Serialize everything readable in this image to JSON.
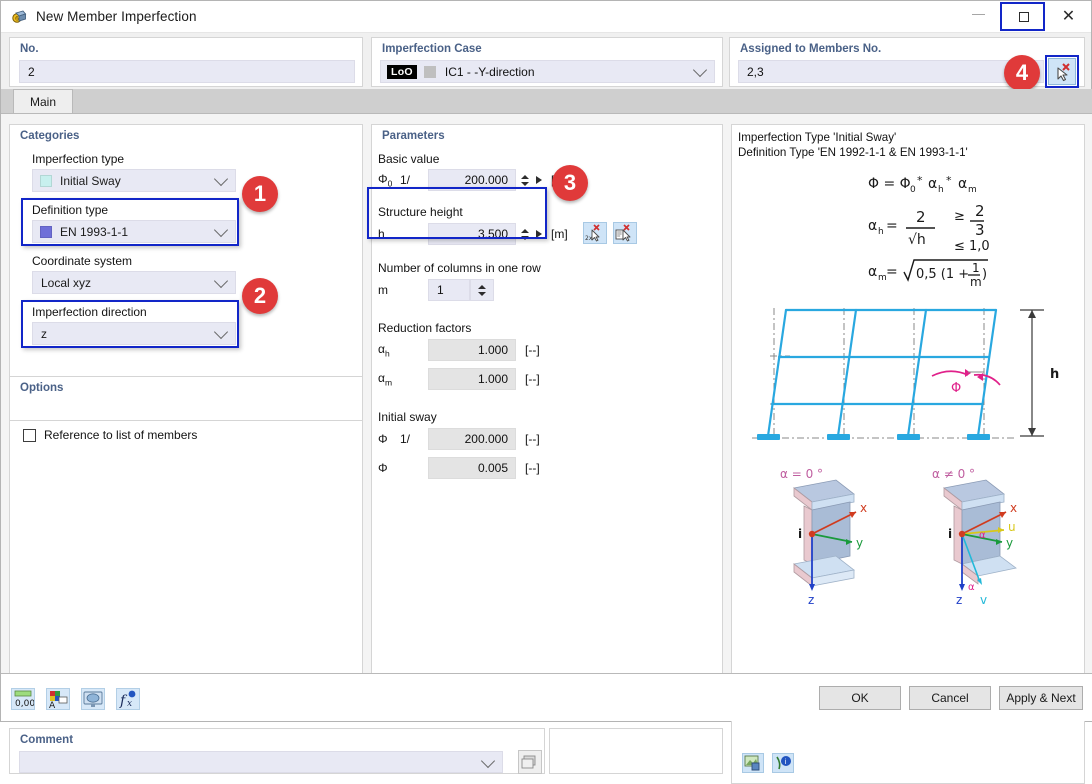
{
  "window": {
    "title": "New Member Imperfection",
    "icon": "imperfection-icon",
    "minimize": "—",
    "maximize": "maximize-icon",
    "close": "✕"
  },
  "top": {
    "no": {
      "label": "No.",
      "value": "2"
    },
    "case": {
      "label": "Imperfection Case",
      "tag": "LoO",
      "value": "IC1 - -Y-direction"
    },
    "assigned": {
      "label": "Assigned to Members No.",
      "value": "2,3",
      "pick_button": "select-members-icon"
    }
  },
  "badges": [
    "1",
    "2",
    "3",
    "4"
  ],
  "tabs": [
    {
      "label": "Main",
      "active": true
    }
  ],
  "categories": {
    "title": "Categories",
    "fields": [
      {
        "label": "Imperfection type",
        "value": "Initial Sway",
        "swatch": "#c7f0ee"
      },
      {
        "label": "Definition type",
        "value": "EN 1993-1-1",
        "swatch": "#6f6fd8"
      },
      {
        "label": "Coordinate system",
        "value": "Local xyz",
        "swatch": ""
      },
      {
        "label": "Imperfection direction",
        "value": "z",
        "swatch": ""
      }
    ]
  },
  "options": {
    "title": "Options",
    "checkbox_label": "Reference to list of members",
    "checked": false
  },
  "parameters": {
    "title": "Parameters",
    "basic_value": {
      "label": "Basic value",
      "symbol": "Φ",
      "symbol_sub": "0",
      "prefix": "1/",
      "value": "200.000",
      "unit": "[--]"
    },
    "structure_height": {
      "label": "Structure height",
      "symbol": "h",
      "value": "3.500",
      "unit": "[m]",
      "tool1": "pick-length-icon",
      "tool2": "pick-from-list-icon"
    },
    "columns": {
      "label": "Number of columns in one row",
      "symbol": "m",
      "value": "1"
    },
    "reduction": {
      "label": "Reduction factors",
      "rows": [
        {
          "symbol": "α",
          "sub": "h",
          "value": "1.000",
          "unit": "[--]"
        },
        {
          "symbol": "α",
          "sub": "m",
          "value": "1.000",
          "unit": "[--]"
        }
      ]
    },
    "initial_sway": {
      "label": "Initial sway",
      "rows": [
        {
          "symbol": "Φ",
          "sub": "",
          "prefix": "1/",
          "value": "200.000",
          "unit": "[--]"
        },
        {
          "symbol": "Φ",
          "sub": "",
          "prefix": "",
          "value": "0.005",
          "unit": "[--]"
        }
      ]
    }
  },
  "image_panel": {
    "line1": "Imperfection Type 'Initial Sway'",
    "line2": "Definition Type 'EN 1992-1-1 & EN 1993-1-1'",
    "formula_main": "Φ = Φ₀ * αₕ * αₘ",
    "formula_ah_lhs": "αₕ =",
    "formula_ah_num": "2",
    "formula_ah_den": "√h",
    "formula_ah_cond1": "≥ 2/3",
    "formula_ah_cond2": "≤ 1,0",
    "formula_am_lhs": "αₘ =",
    "formula_am_body": "0,5 (1 + 1/m )",
    "diagram_h_label": "h",
    "diagram_phi_label": "Φ",
    "section_left_label": "α = 0 °",
    "section_right_label": "α ≠ 0 °",
    "axis_labels": [
      "x",
      "y",
      "z",
      "i",
      "u",
      "v",
      "α"
    ],
    "icons": [
      "render-image-icon",
      "info-icon"
    ]
  },
  "comment": {
    "title": "Comment",
    "value": "",
    "button": "comment-picker-icon"
  },
  "footer": {
    "left_icons": [
      "decimal-places-icon",
      "units-icon",
      "display-icon",
      "formula-icon"
    ],
    "buttons": [
      {
        "label": "OK",
        "name": "ok-button"
      },
      {
        "label": "Cancel",
        "name": "cancel-button"
      },
      {
        "label": "Apply & Next",
        "name": "apply-next-button"
      }
    ]
  },
  "colors": {
    "accent_blue": "#1226c8",
    "badge_red": "#e03a3a",
    "group_label": "#4a6187",
    "field_bg": "#e8e9f4",
    "diagram_blue": "#29a8e0",
    "diagram_pink": "#e0218a"
  }
}
